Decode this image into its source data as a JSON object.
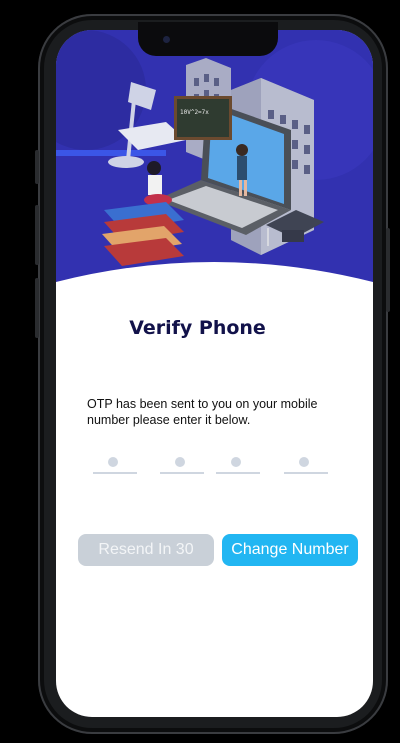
{
  "verify": {
    "title": "Verify Phone",
    "description": "OTP has been sent to you on your mobile number please enter it below."
  },
  "otp": {
    "digits": [
      "",
      "",
      "",
      ""
    ]
  },
  "buttons": {
    "resend_label": "Resend In 30",
    "change_label": "Change Number"
  },
  "colors": {
    "hero_bg": "#3533b8",
    "title": "#12124a",
    "resend_disabled": "#c9d0d8",
    "primary": "#22b6f2"
  },
  "hero": {
    "board_text": "Jah / 10V^2 = 7x^2 / 1/40.2x"
  }
}
